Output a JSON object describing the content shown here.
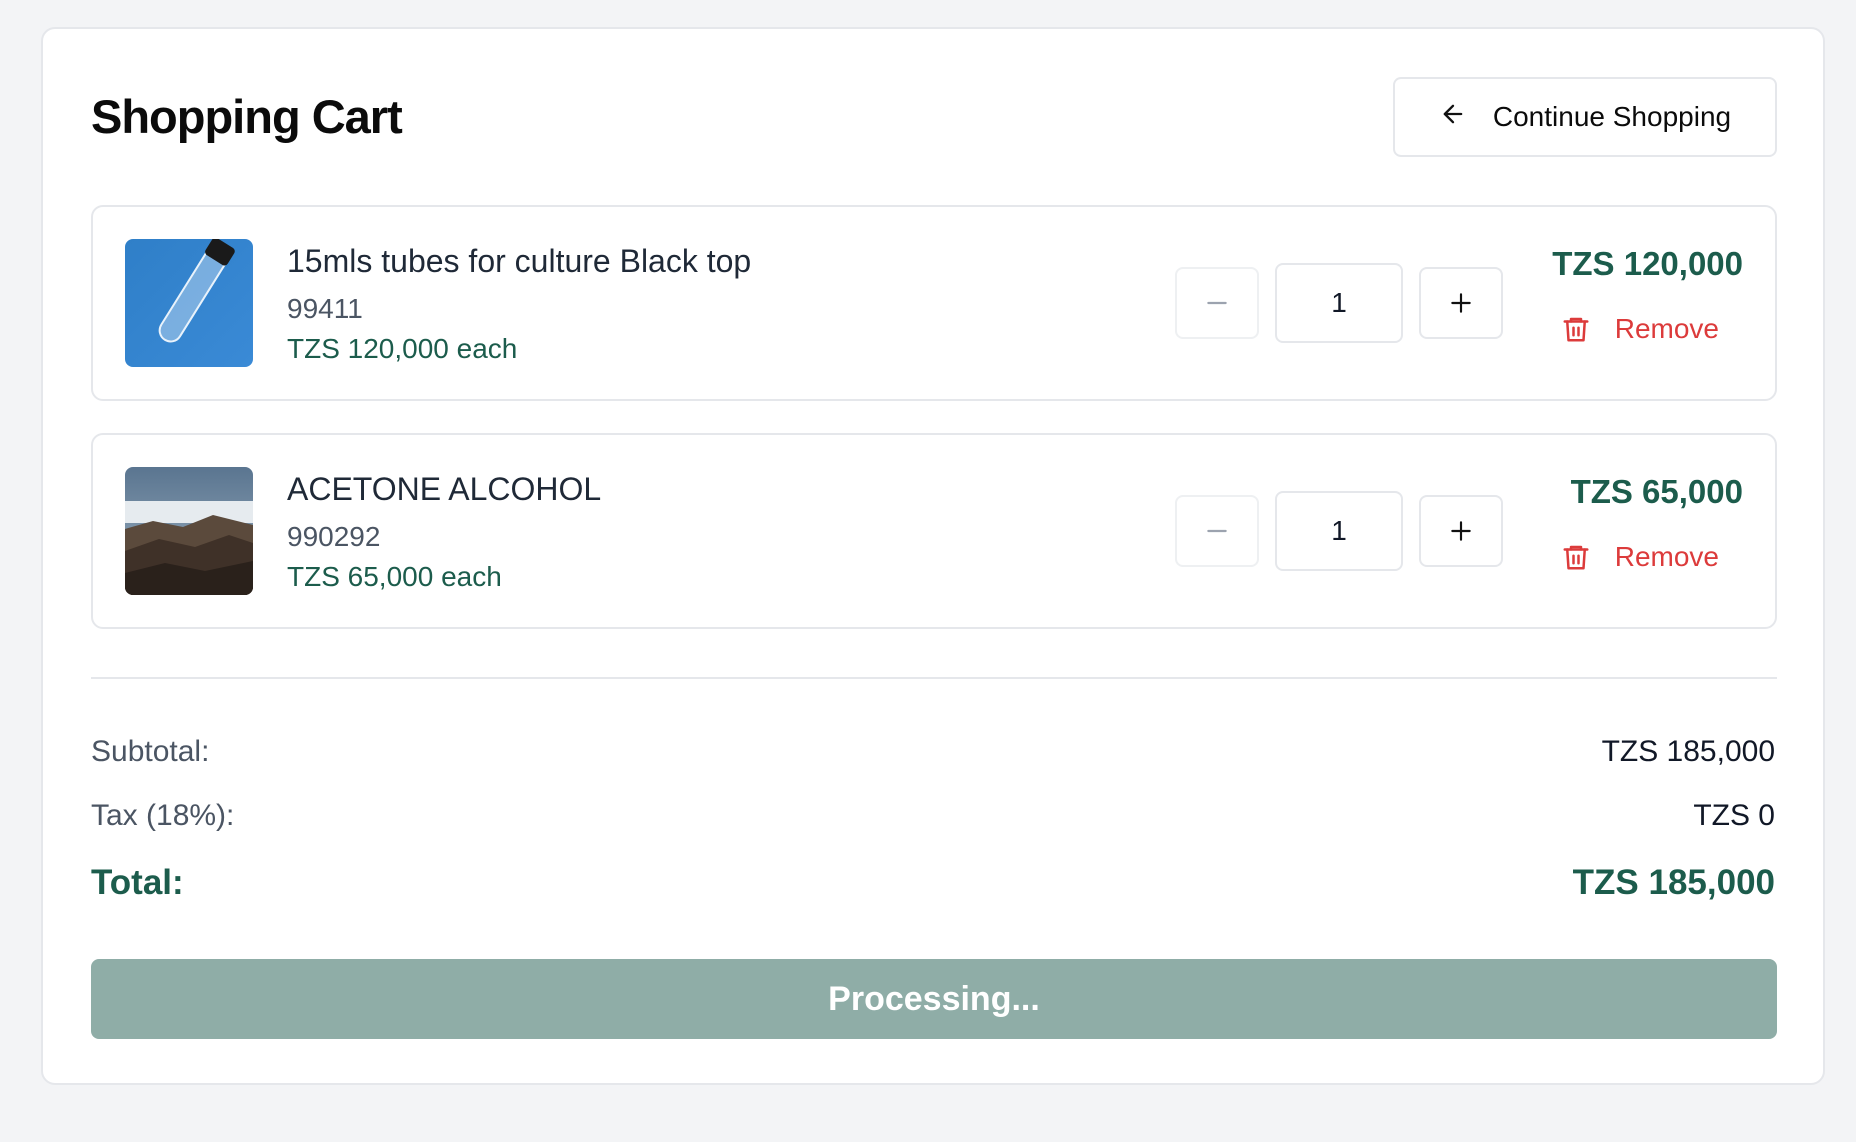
{
  "cart": {
    "title": "Shopping Cart",
    "continue_label": "Continue Shopping",
    "items": [
      {
        "name": "15mls tubes for culture Black top",
        "sku": "99411",
        "unit_price": "TZS 120,000 each",
        "quantity": "1",
        "line_total": "TZS 120,000",
        "remove_label": "Remove"
      },
      {
        "name": "ACETONE ALCOHOL",
        "sku": "990292",
        "unit_price": "TZS 65,000 each",
        "quantity": "1",
        "line_total": "TZS 65,000",
        "remove_label": "Remove"
      }
    ]
  },
  "summary": {
    "subtotal_label": "Subtotal:",
    "subtotal_value": "TZS 185,000",
    "tax_label": "Tax (18%):",
    "tax_value": "TZS 0",
    "total_label": "Total:",
    "total_value": "TZS 185,000",
    "checkout_label": "Processing..."
  },
  "colors": {
    "accent": "#1c5c4c",
    "danger": "#dc3b3b",
    "button_disabled": "#8fada7"
  }
}
